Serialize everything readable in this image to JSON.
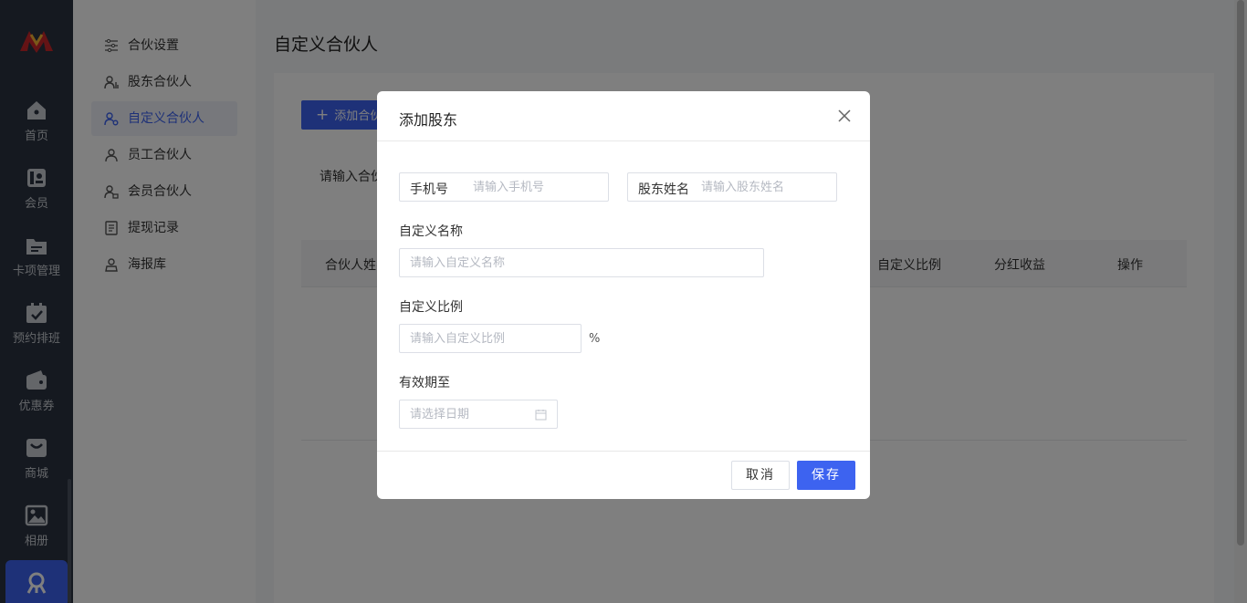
{
  "rail": {
    "items": [
      {
        "label": "首页",
        "icon": "home-icon"
      },
      {
        "label": "会员",
        "icon": "member-card-icon"
      },
      {
        "label": "卡项管理",
        "icon": "folder-icon"
      },
      {
        "label": "预约排班",
        "icon": "calendar-check-icon"
      },
      {
        "label": "优惠券",
        "icon": "wallet-icon"
      },
      {
        "label": "商城",
        "icon": "shop-bag-icon"
      },
      {
        "label": "相册",
        "icon": "image-icon"
      },
      {
        "label": "",
        "icon": "partner-icon"
      }
    ]
  },
  "submenu": {
    "items": [
      {
        "label": "合伙设置",
        "icon": "sliders-icon"
      },
      {
        "label": "股东合伙人",
        "icon": "shareholder-icon"
      },
      {
        "label": "自定义合伙人",
        "icon": "custom-partner-icon",
        "active": true
      },
      {
        "label": "员工合伙人",
        "icon": "staff-icon"
      },
      {
        "label": "会员合伙人",
        "icon": "member-partner-icon"
      },
      {
        "label": "提现记录",
        "icon": "record-icon"
      },
      {
        "label": "海报库",
        "icon": "poster-icon"
      }
    ]
  },
  "page": {
    "title": "自定义合伙人",
    "add_button": "添加合伙人",
    "filter_label": "请输入合伙人",
    "table_headers": [
      "合伙人姓名",
      "自定义比例",
      "分红收益",
      "操作"
    ]
  },
  "modal": {
    "title": "添加股东",
    "phone": {
      "label": "手机号",
      "placeholder": "请输入手机号",
      "value": ""
    },
    "name": {
      "label": "股东姓名",
      "placeholder": "请输入股东姓名",
      "value": ""
    },
    "custom_name": {
      "label": "自定义名称",
      "placeholder": "请输入自定义名称",
      "value": ""
    },
    "custom_ratio": {
      "label": "自定义比例",
      "placeholder": "请输入自定义比例",
      "value": "",
      "unit": "%"
    },
    "valid_until": {
      "label": "有效期至",
      "placeholder": "请选择日期",
      "value": ""
    },
    "cancel": "取消",
    "save": "保存"
  },
  "colors": {
    "primary": "#3d63f0",
    "rail_bg": "#2b3340"
  }
}
